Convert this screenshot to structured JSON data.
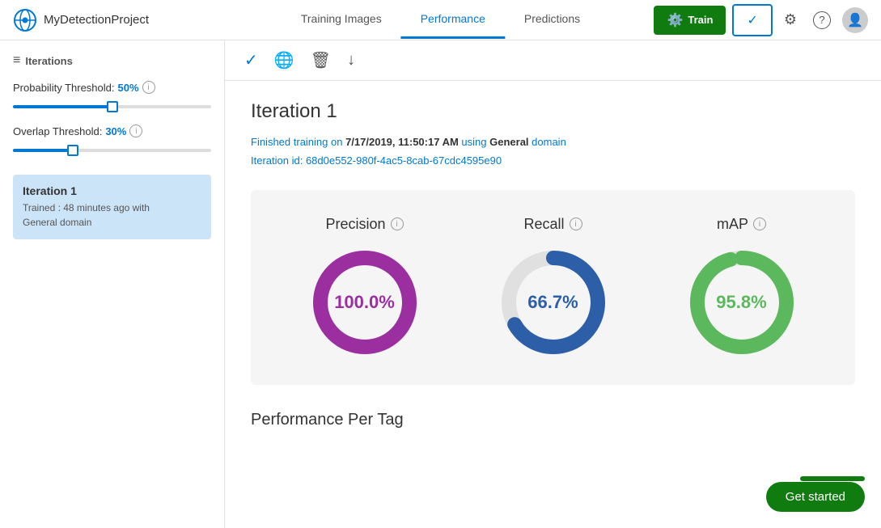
{
  "header": {
    "project_name": "MyDetectionProject",
    "nav_tabs": [
      {
        "label": "Training Images",
        "id": "training-images",
        "active": false
      },
      {
        "label": "Performance",
        "id": "performance",
        "active": true
      },
      {
        "label": "Predictions",
        "id": "predictions",
        "active": false
      }
    ],
    "btn_train_label": "",
    "btn_check_label": "",
    "settings_tooltip": "Settings",
    "help_tooltip": "Help"
  },
  "sidebar": {
    "section_title": "Iterations",
    "probability_threshold_label": "Probability Threshold:",
    "probability_threshold_value": "50%",
    "overlap_threshold_label": "Overlap Threshold:",
    "overlap_threshold_value": "30%",
    "iteration": {
      "title": "Iteration 1",
      "trained_ago": "Trained : 48 minutes ago with",
      "domain": "General domain"
    }
  },
  "toolbar": {
    "check_icon": "✓",
    "globe_icon": "🌐",
    "trash_icon": "🗑",
    "download_icon": "↓"
  },
  "content": {
    "iteration_title": "Iteration 1",
    "meta_line1_prefix": "Finished training on ",
    "meta_date": "7/17/2019, 11:50:17 AM",
    "meta_line1_mid": " using ",
    "meta_domain": "General",
    "meta_line1_suffix": " domain",
    "meta_line2_prefix": "Iteration id: ",
    "meta_id": "68d0e552-980f-4ac5-8cab-67cdc4595e90",
    "metrics": [
      {
        "label": "Precision",
        "value": "100.0%",
        "color": "#9b2fa0",
        "percent": 100
      },
      {
        "label": "Recall",
        "value": "66.7%",
        "color": "#2c5fa8",
        "percent": 66.7
      },
      {
        "label": "mAP",
        "value": "95.8%",
        "color": "#5cb85c",
        "percent": 95.8
      }
    ],
    "performance_per_tag_label": "Performance Per Tag",
    "get_started_label": "Get started"
  },
  "colors": {
    "accent_blue": "#0078d4",
    "train_green": "#107c10",
    "precision_purple": "#9b2fa0",
    "recall_blue": "#2c5fa8",
    "map_green": "#5cb85c"
  }
}
